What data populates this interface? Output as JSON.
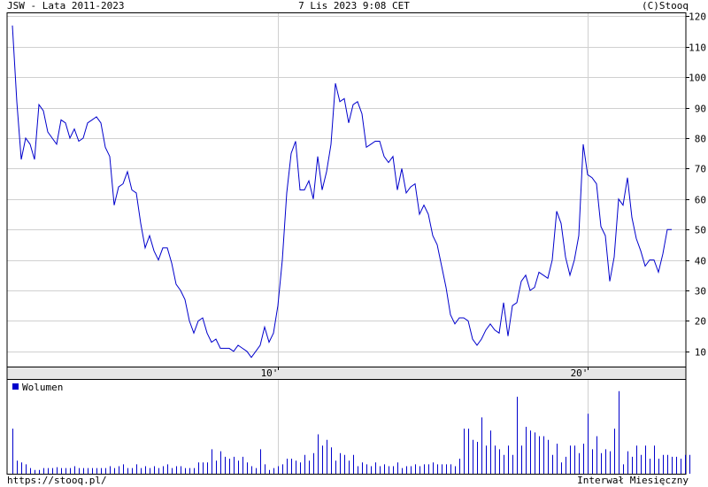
{
  "header": {
    "title": "JSW - Lata 2011-2023",
    "timestamp": "7 Lis 2023 9:08 CET",
    "copyright": "(C)Stooq"
  },
  "footer": {
    "url": "https://stooq.pl/",
    "interval": "Interwał Miesięczny"
  },
  "colors": {
    "price_line": "#0000cc",
    "volume_bars": "#0000cc",
    "grid": "#d0d0d0",
    "axis": "#000000"
  },
  "chart_data": [
    {
      "type": "line",
      "series": [
        {
          "values": [
            117,
            92,
            73,
            80,
            78,
            73,
            91,
            89,
            82,
            80,
            78,
            86,
            85,
            80,
            83,
            79,
            80,
            85,
            86,
            87,
            85,
            77,
            74,
            58,
            64,
            65,
            69,
            63,
            62,
            52,
            44,
            48,
            43,
            40,
            44,
            44,
            39,
            32,
            30,
            27,
            20,
            16,
            20,
            21,
            16,
            13,
            14,
            11,
            11,
            11,
            10,
            12,
            11,
            10,
            8,
            10,
            12,
            18,
            13,
            16,
            25,
            40,
            62,
            75,
            79,
            63,
            63,
            66,
            60,
            74,
            63,
            69,
            78,
            98,
            92,
            93,
            85,
            91,
            92,
            88,
            77,
            78,
            79,
            79,
            74,
            72,
            74,
            63,
            70,
            62,
            64,
            65,
            55,
            58,
            55,
            48,
            45,
            38,
            31,
            22,
            19,
            21,
            21,
            20,
            14,
            12,
            14,
            17,
            19,
            17,
            16,
            26,
            15,
            25,
            26,
            33,
            35,
            30,
            31,
            36,
            35,
            34,
            40,
            56,
            52,
            41,
            35,
            40,
            48,
            78,
            68,
            67,
            65,
            51,
            48,
            33,
            41,
            60,
            58,
            67,
            54,
            47,
            43,
            38,
            40,
            40,
            36,
            42,
            50,
            50
          ]
        }
      ],
      "x_ticks": [
        {
          "label": "10'",
          "index": 60
        },
        {
          "label": "20'",
          "index": 130
        }
      ],
      "y_axis": {
        "ticks": [
          10,
          20,
          30,
          40,
          50,
          60,
          70,
          80,
          90,
          100,
          110,
          120
        ],
        "range": [
          5,
          121
        ],
        "position": "right"
      },
      "grid": true
    },
    {
      "type": "bar",
      "legend": {
        "label": "Wolumen",
        "placement": "top-left"
      },
      "values": [
        48,
        14,
        12,
        10,
        6,
        4,
        4,
        6,
        6,
        6,
        7,
        6,
        6,
        6,
        8,
        6,
        6,
        6,
        6,
        6,
        6,
        6,
        8,
        6,
        8,
        10,
        6,
        6,
        10,
        6,
        8,
        6,
        8,
        6,
        8,
        10,
        6,
        8,
        8,
        6,
        6,
        6,
        12,
        12,
        12,
        26,
        14,
        24,
        18,
        16,
        18,
        14,
        18,
        12,
        8,
        6,
        26,
        10,
        4,
        6,
        8,
        10,
        16,
        16,
        14,
        12,
        20,
        14,
        22,
        42,
        30,
        36,
        28,
        14,
        22,
        20,
        14,
        20,
        8,
        12,
        10,
        8,
        12,
        8,
        10,
        8,
        8,
        12,
        6,
        8,
        8,
        10,
        8,
        10,
        10,
        12,
        10,
        10,
        10,
        10,
        8,
        16,
        48,
        48,
        36,
        34,
        60,
        30,
        46,
        30,
        26,
        20,
        30,
        20,
        82,
        30,
        50,
        46,
        44,
        40,
        40,
        36,
        20,
        32,
        12,
        18,
        30,
        30,
        22,
        32,
        64,
        26,
        40,
        22,
        26,
        24,
        48,
        88,
        10,
        24,
        18,
        30,
        20,
        30,
        16,
        30,
        16,
        20,
        20,
        18,
        18,
        16,
        20,
        20
      ]
    }
  ]
}
